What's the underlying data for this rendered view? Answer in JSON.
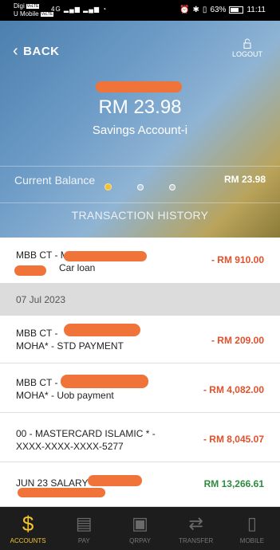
{
  "statusbar": {
    "carrier1": "Digi",
    "carrier2": "U Mobile",
    "volte": "VoLTE",
    "net": "4G",
    "battery": "63%",
    "time": "11:11"
  },
  "header": {
    "back_label": "BACK",
    "logout_label": "LOGOUT",
    "balance": "RM 23.98",
    "account_type": "Savings Account-i",
    "current_balance_label": "Current Balance",
    "current_balance_value": "RM 23.98",
    "carousel_pages": 3,
    "carousel_active": 0,
    "section_title": "TRANSACTION HISTORY"
  },
  "transactions": [
    {
      "line1": "MBB CT - M",
      "line2": "Car loan",
      "amount": "- RM 910.00",
      "type": "debit"
    },
    {
      "date_header": "07 Jul 2023"
    },
    {
      "line1": "MBB CT -",
      "line2": "MOHA* - STD PAYMENT",
      "amount": "- RM 209.00",
      "type": "debit"
    },
    {
      "line1": "MBB CT -",
      "line2": "MOHA* - Uob payment",
      "amount": "- RM 4,082.00",
      "type": "debit"
    },
    {
      "line1": "00 - MASTERCARD ISLAMIC * -",
      "line2": "XXXX-XXXX-XXXX-5277",
      "amount": "- RM 8,045.07",
      "type": "debit"
    },
    {
      "line1": "JUN 23 SALARY -",
      "line2": "",
      "amount": "RM 13,266.61",
      "type": "credit"
    }
  ],
  "tabs": [
    {
      "label": "ACCOUNTS",
      "icon": "dollar-icon",
      "active": true
    },
    {
      "label": "PAY",
      "icon": "bill-icon",
      "active": false
    },
    {
      "label": "QRPAY",
      "icon": "qr-icon",
      "active": false
    },
    {
      "label": "TRANSFER",
      "icon": "transfer-icon",
      "active": false
    },
    {
      "label": "MOBILE",
      "icon": "mobile-icon",
      "active": false
    }
  ],
  "colors": {
    "debit": "#e0502c",
    "credit": "#2e8b3e",
    "accent": "#f1c232"
  }
}
